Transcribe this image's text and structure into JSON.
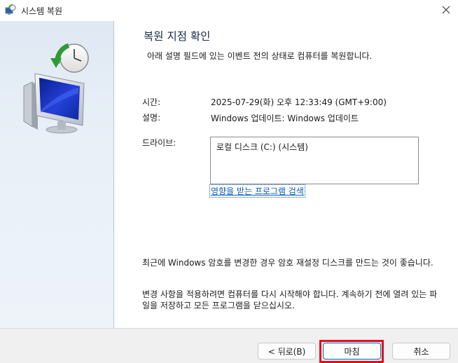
{
  "window": {
    "title": "시스템 복원",
    "close_label": "✕"
  },
  "page": {
    "heading": "복원 지점 확인",
    "subtitle": "아래 설명 필드에 있는 이벤트 전의 상태로 컴퓨터를 복원합니다."
  },
  "details": {
    "time_label": "시간:",
    "time_value": "2025-07-29(화) 오후 12:33:49 (GMT+9:00)",
    "description_label": "설명:",
    "description_value": "Windows 업데이트: Windows 업데이트",
    "drives_label": "드라이브:",
    "drives": [
      "로컬 디스크 (C:) (시스템)"
    ],
    "affected_programs_link": "영향을 받는 프로그램 검색"
  },
  "notes": {
    "password_note": "최근에 Windows 암호를 변경한 경우 암호 재설정 디스크를 만드는 것이 좋습니다.",
    "restart_note": "변경 사항을 적용하려면 컴퓨터를 다시 시작해야 합니다. 계속하기 전에 열려 있는 파일을 저장하고 모든 프로그램을 닫으십시오."
  },
  "buttons": {
    "back": "< 뒤로(B)",
    "finish": "마침",
    "cancel": "취소"
  },
  "colors": {
    "sidebar": "#dfe8f3",
    "link": "#0a5db4",
    "highlight": "#e0101b",
    "footer": "#f0f0f0"
  },
  "icons": {
    "app": "system-restore-icon",
    "sidebar": "computer-restore-clock-icon",
    "close": "close-icon"
  }
}
